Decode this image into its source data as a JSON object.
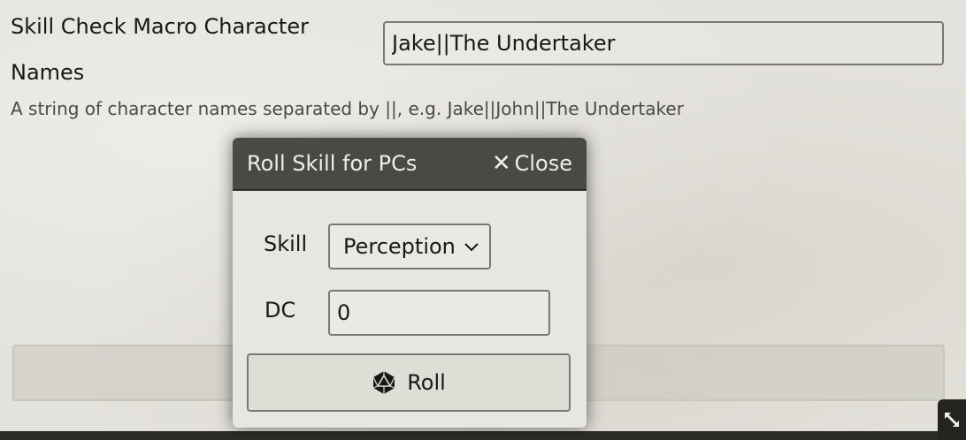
{
  "setting": {
    "label": "Skill Check Macro Character Names",
    "value": "Jake||The Undertaker",
    "hint": "A string of character names separated by ||, e.g. Jake||John||The Undertaker"
  },
  "dialog": {
    "title": "Roll Skill for PCs",
    "close_label": "Close",
    "skill_label": "Skill",
    "skill_selected": "Perception",
    "dc_label": "DC",
    "dc_value": "0",
    "roll_label": "Roll"
  },
  "icons": {
    "close": "close-icon",
    "select": "chevron-down-icon",
    "roll": "dice-d20-icon",
    "resize": "resize-arrows-icon"
  },
  "colors": {
    "header_bg": "#4a4944",
    "page_bg": "#e4e2dc",
    "text": "#191813"
  }
}
